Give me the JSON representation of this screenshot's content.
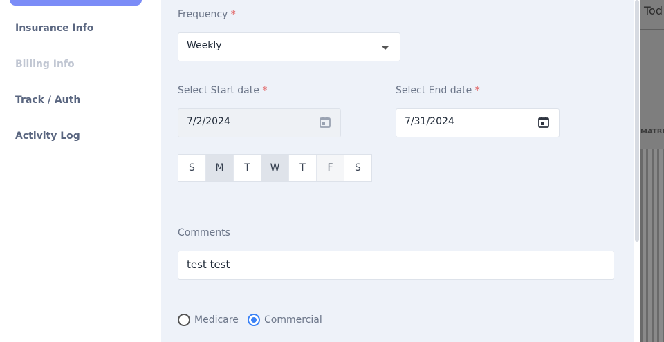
{
  "sidebar": {
    "items": [
      {
        "label": "Insurance Info",
        "enabled": true
      },
      {
        "label": "Billing Info",
        "enabled": false
      },
      {
        "label": "Track / Auth",
        "enabled": true
      },
      {
        "label": "Activity Log",
        "enabled": true
      }
    ]
  },
  "form": {
    "frequency": {
      "label": "Frequency",
      "required": "*",
      "value": "Weekly"
    },
    "start_date": {
      "label": "Select Start date",
      "required": "*",
      "value": "7/2/2024"
    },
    "end_date": {
      "label": "Select End date",
      "required": "*",
      "value": "7/31/2024"
    },
    "days": [
      {
        "label": "S",
        "selected": false
      },
      {
        "label": "M",
        "selected": true
      },
      {
        "label": "T",
        "selected": false
      },
      {
        "label": "W",
        "selected": true
      },
      {
        "label": "T",
        "selected": false
      },
      {
        "label": "F",
        "selected": false
      },
      {
        "label": "S",
        "selected": false
      }
    ],
    "comments": {
      "label": "Comments",
      "value": "test test"
    },
    "payer": {
      "options": [
        "Medicare",
        "Commercial"
      ],
      "selected": "Commercial"
    }
  },
  "background": {
    "header_text": "Tod",
    "column_text": "MATRI"
  },
  "colors": {
    "accent": "#3b82f6",
    "active_nav": "#7b8cf7",
    "required": "#e05454",
    "panel_bg": "#eef2f9"
  },
  "icons": {
    "start_date": "calendar-icon",
    "end_date": "calendar-icon",
    "frequency": "chevron-down-icon"
  }
}
